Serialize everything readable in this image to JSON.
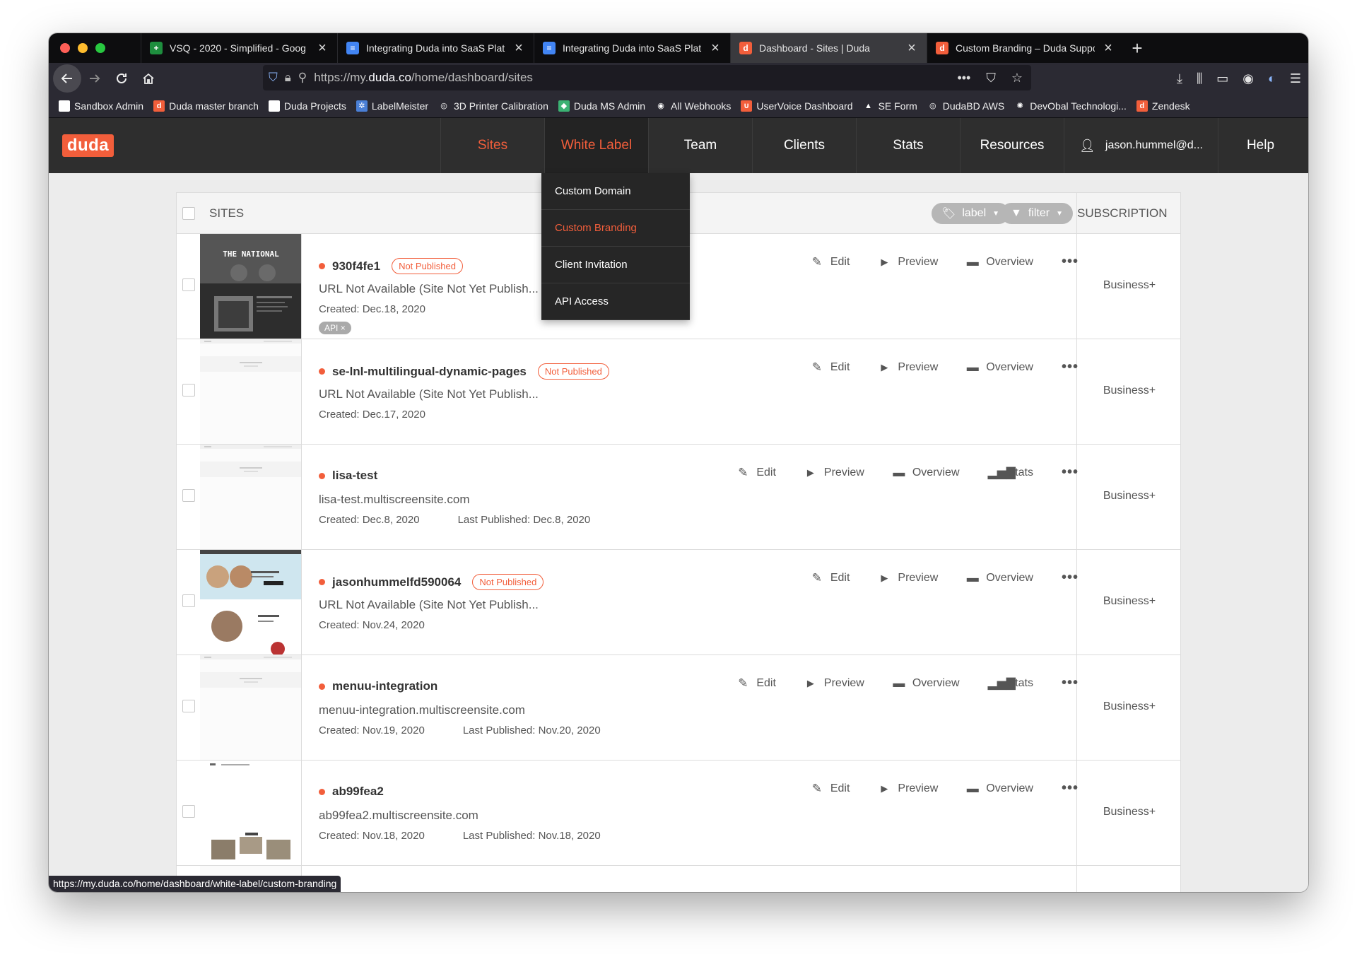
{
  "browser": {
    "tabs": [
      {
        "title": "VSQ - 2020 - Simplified - Goog",
        "icon_color": "#1e8e3e",
        "icon_glyph": "+",
        "active": false
      },
      {
        "title": "Integrating Duda into SaaS Plat",
        "icon_color": "#4285f4",
        "icon_glyph": "≡",
        "active": false
      },
      {
        "title": "Integrating Duda into SaaS Plat",
        "icon_color": "#4285f4",
        "icon_glyph": "≡",
        "active": false
      },
      {
        "title": "Dashboard - Sites | Duda",
        "icon_color": "#f25e3b",
        "icon_glyph": "d",
        "active": true
      },
      {
        "title": "Custom Branding – Duda Suppo",
        "icon_color": "#f25e3b",
        "icon_glyph": "d",
        "active": false
      }
    ],
    "url_prefix": "https://my.",
    "url_host": "duda.co",
    "url_path": "/home/dashboard/sites",
    "bookmarks": [
      {
        "label": "Sandbox Admin",
        "icon_color": "#ffffff",
        "icon_glyph": ""
      },
      {
        "label": "Duda master branch",
        "icon_color": "#f25e3b",
        "icon_glyph": "d"
      },
      {
        "label": "Duda Projects",
        "icon_color": "#ffffff",
        "icon_glyph": ""
      },
      {
        "label": "LabelMeister",
        "icon_color": "#4a7fd6",
        "icon_glyph": "✲"
      },
      {
        "label": "3D Printer Calibration",
        "icon_color": "#2b2a33",
        "icon_glyph": "◎"
      },
      {
        "label": "Duda MS Admin",
        "icon_color": "#3bb273",
        "icon_glyph": "◆"
      },
      {
        "label": "All Webhooks",
        "icon_color": "#2b2a33",
        "icon_glyph": "◉"
      },
      {
        "label": "UserVoice Dashboard",
        "icon_color": "#f25e3b",
        "icon_glyph": "∪"
      },
      {
        "label": "SE Form",
        "icon_color": "#2b2a33",
        "icon_glyph": "▲"
      },
      {
        "label": "DudaBD AWS",
        "icon_color": "#2b2a33",
        "icon_glyph": "◎"
      },
      {
        "label": "DevObal Technologi...",
        "icon_color": "#2b2a33",
        "icon_glyph": "✺"
      },
      {
        "label": "Zendesk",
        "icon_color": "#f25e3b",
        "icon_glyph": "d"
      }
    ],
    "status_url": "https://my.duda.co/home/dashboard/white-label/custom-branding"
  },
  "app": {
    "logo": "duda",
    "accent": "#f25e3b",
    "menu": [
      {
        "label": "Sites",
        "state": "active"
      },
      {
        "label": "White Label",
        "state": "open"
      },
      {
        "label": "Team",
        "state": ""
      },
      {
        "label": "Clients",
        "state": ""
      },
      {
        "label": "Stats",
        "state": ""
      },
      {
        "label": "Resources",
        "state": ""
      },
      {
        "label": "jason.hummel@d...",
        "state": "user"
      },
      {
        "label": "Help",
        "state": ""
      }
    ],
    "white_label_menu": [
      {
        "label": "Custom Domain",
        "highlight": false
      },
      {
        "label": "Custom Branding",
        "highlight": true
      },
      {
        "label": "Client Invitation",
        "highlight": false
      },
      {
        "label": "API Access",
        "highlight": false
      }
    ]
  },
  "sites_table": {
    "header": "SITES",
    "label_filter": "label",
    "filter": "filter",
    "subscription_header": "SUBSCRIPTION",
    "actions": {
      "edit": "Edit",
      "preview": "Preview",
      "overview": "Overview",
      "stats": "Stats"
    },
    "rows": [
      {
        "name": "930f4fe1",
        "badge": "Not Published",
        "url": "URL Not Available (Site Not Yet Publish...",
        "created": "Created: Dec.18, 2020",
        "published": "",
        "tag": "API",
        "has_stats": false,
        "subscription": "Business+",
        "thumb": "national"
      },
      {
        "name": "se-lnl-multilingual-dynamic-pages",
        "badge": "Not Published",
        "url": "URL Not Available (Site Not Yet Publish...",
        "created": "Created: Dec.17, 2020",
        "published": "",
        "tag": "",
        "has_stats": false,
        "subscription": "Business+",
        "thumb": "blank"
      },
      {
        "name": "lisa-test",
        "badge": "",
        "url": "lisa-test.multiscreensite.com",
        "created": "Created: Dec.8, 2020",
        "published": "Last Published: Dec.8, 2020",
        "tag": "",
        "has_stats": true,
        "subscription": "Business+",
        "thumb": "blank"
      },
      {
        "name": "jasonhummelfd590064",
        "badge": "Not Published",
        "url": "URL Not Available (Site Not Yet Publish...",
        "created": "Created: Nov.24, 2020",
        "published": "",
        "tag": "",
        "has_stats": false,
        "subscription": "Business+",
        "thumb": "eyewear"
      },
      {
        "name": "menuu-integration",
        "badge": "",
        "url": "menuu-integration.multiscreensite.com",
        "created": "Created: Nov.19, 2020",
        "published": "Last Published: Nov.20, 2020",
        "tag": "",
        "has_stats": true,
        "subscription": "Business+",
        "thumb": "blank"
      },
      {
        "name": "ab99fea2",
        "badge": "",
        "url": "ab99fea2.multiscreensite.com",
        "created": "Created: Nov.18, 2020",
        "published": "Last Published: Nov.18, 2020",
        "tag": "",
        "has_stats": false,
        "subscription": "Business+",
        "thumb": "gallery"
      }
    ]
  }
}
